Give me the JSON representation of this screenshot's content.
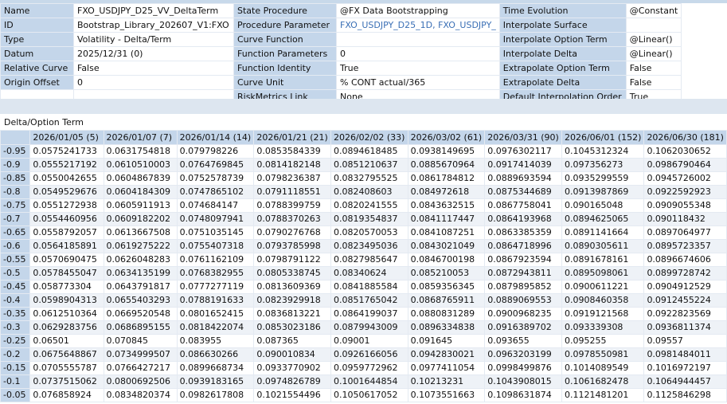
{
  "properties": [
    [
      {
        "label": "Name",
        "value": "FXO_USDJPY_D25_VV_DeltaTerm"
      },
      {
        "label": "State Procedure",
        "value": "@FX Data Bootstrapping"
      },
      {
        "label": "Time Evolution",
        "value": "@Constant"
      }
    ],
    [
      {
        "label": "ID",
        "value": "Bootstrap_Library_202607_V1:FXO"
      },
      {
        "label": "Procedure Parameter",
        "value": "FXO_USDJPY_D25_1D, FXO_USDJPY_",
        "link": true
      },
      {
        "label": "Interpolate Surface",
        "value": ""
      }
    ],
    [
      {
        "label": "Type",
        "value": "Volatility - Delta/Term"
      },
      {
        "label": "Curve Function",
        "value": ""
      },
      {
        "label": "Interpolate Option Term",
        "value": "@Linear()"
      }
    ],
    [
      {
        "label": "Datum",
        "value": "2025/12/31 (0)"
      },
      {
        "label": "Function Parameters",
        "value": "0"
      },
      {
        "label": "Interpolate Delta",
        "value": "@Linear()"
      }
    ],
    [
      {
        "label": "Relative Curve",
        "value": "False"
      },
      {
        "label": "Function Identity",
        "value": "True"
      },
      {
        "label": "Extrapolate Option Term",
        "value": "False"
      }
    ],
    [
      {
        "label": "Origin Offset",
        "value": "0"
      },
      {
        "label": "Curve Unit",
        "value": "% CONT actual/365"
      },
      {
        "label": "Extrapolate Delta",
        "value": "False"
      }
    ],
    [
      {
        "label": "",
        "value": ""
      },
      {
        "label": "RiskMetrics Link",
        "value": "None"
      },
      {
        "label": "Default Interpolation Order",
        "value": "True"
      }
    ]
  ],
  "grid": {
    "title": "Delta/Option Term",
    "columns": [
      "2026/01/05 (5)",
      "2026/01/07 (7)",
      "2026/01/14 (14)",
      "2026/01/21 (21)",
      "2026/02/02 (33)",
      "2026/03/02 (61)",
      "2026/03/31 (90)",
      "2026/06/01 (152)",
      "2026/06/30 (181)"
    ],
    "rows": [
      {
        "delta": "-0.95",
        "values": [
          "0.0575241733",
          "0.0631754818",
          "0.079798226",
          "0.0853584339",
          "0.0894618485",
          "0.0938149695",
          "0.0976302117",
          "0.1045312324",
          "0.1062030652"
        ]
      },
      {
        "delta": "-0.9",
        "values": [
          "0.0555217192",
          "0.0610510003",
          "0.0764769845",
          "0.0814182148",
          "0.0851210637",
          "0.0885670964",
          "0.0917414039",
          "0.097356273",
          "0.0986790464"
        ]
      },
      {
        "delta": "-0.85",
        "values": [
          "0.0550042655",
          "0.0604867839",
          "0.0752578739",
          "0.0798236387",
          "0.0832795525",
          "0.0861784812",
          "0.0889693594",
          "0.0935299559",
          "0.0945726002"
        ]
      },
      {
        "delta": "-0.8",
        "values": [
          "0.0549529676",
          "0.0604184309",
          "0.0747865102",
          "0.0791118551",
          "0.082408603",
          "0.084972618",
          "0.0875344689",
          "0.0913987869",
          "0.0922592923"
        ]
      },
      {
        "delta": "-0.75",
        "values": [
          "0.0551272938",
          "0.0605911913",
          "0.074684147",
          "0.0788399759",
          "0.0820241555",
          "0.0843632515",
          "0.0867758041",
          "0.090165048",
          "0.0909055348"
        ]
      },
      {
        "delta": "-0.7",
        "values": [
          "0.0554460956",
          "0.0609182202",
          "0.0748097941",
          "0.0788370263",
          "0.0819354837",
          "0.0841117447",
          "0.0864193968",
          "0.0894625065",
          "0.090118432"
        ]
      },
      {
        "delta": "-0.65",
        "values": [
          "0.0558792057",
          "0.0613667508",
          "0.0751035145",
          "0.0790276768",
          "0.0820570053",
          "0.0841087251",
          "0.0863385359",
          "0.0891141664",
          "0.0897064977"
        ]
      },
      {
        "delta": "-0.6",
        "values": [
          "0.0564185891",
          "0.0619275222",
          "0.0755407318",
          "0.0793785998",
          "0.0823495036",
          "0.0843021049",
          "0.0864718996",
          "0.0890305611",
          "0.0895723357"
        ]
      },
      {
        "delta": "-0.55",
        "values": [
          "0.0570690475",
          "0.0626048283",
          "0.0761162109",
          "0.0798791122",
          "0.0827985647",
          "0.0846700198",
          "0.0867923594",
          "0.0891678161",
          "0.0896674606"
        ]
      },
      {
        "delta": "-0.5",
        "values": [
          "0.0578455047",
          "0.0634135199",
          "0.0768382955",
          "0.0805338745",
          "0.08340624",
          "0.085210053",
          "0.0872943811",
          "0.0895098061",
          "0.0899728742"
        ]
      },
      {
        "delta": "-0.45",
        "values": [
          "0.058773304",
          "0.0643791817",
          "0.0777277119",
          "0.0813609369",
          "0.0841885584",
          "0.0859356345",
          "0.0879895852",
          "0.0900611221",
          "0.0904912529"
        ]
      },
      {
        "delta": "-0.4",
        "values": [
          "0.0598904313",
          "0.0655403293",
          "0.0788191633",
          "0.0823929918",
          "0.0851765042",
          "0.0868765911",
          "0.0889069553",
          "0.0908460358",
          "0.0912455224"
        ]
      },
      {
        "delta": "-0.35",
        "values": [
          "0.0612510364",
          "0.0669520548",
          "0.0801652415",
          "0.0836813221",
          "0.0864199037",
          "0.0880831289",
          "0.0900968235",
          "0.0919121568",
          "0.0922823569"
        ]
      },
      {
        "delta": "-0.3",
        "values": [
          "0.0629283756",
          "0.0686895155",
          "0.0818422074",
          "0.0853023186",
          "0.0879943009",
          "0.0896334838",
          "0.0916389702",
          "0.093339308",
          "0.0936811374"
        ]
      },
      {
        "delta": "-0.25",
        "values": [
          "0.06501",
          "0.070845",
          "0.083955",
          "0.087365",
          "0.09001",
          "0.091645",
          "0.093655",
          "0.095255",
          "0.09557"
        ]
      },
      {
        "delta": "-0.2",
        "values": [
          "0.0675648867",
          "0.0734999507",
          "0.086630266",
          "0.090010834",
          "0.0926166056",
          "0.0942830021",
          "0.0963203199",
          "0.0978550981",
          "0.0981484011"
        ]
      },
      {
        "delta": "-0.15",
        "values": [
          "0.0705555787",
          "0.0766427217",
          "0.0899668734",
          "0.0933770902",
          "0.0959772962",
          "0.0977411054",
          "0.0998499876",
          "0.1014089549",
          "0.1016972197"
        ]
      },
      {
        "delta": "-0.1",
        "values": [
          "0.0737515062",
          "0.0800692506",
          "0.0939183165",
          "0.0974826789",
          "0.1001644854",
          "0.10213231",
          "0.1043908015",
          "0.1061682478",
          "0.1064944457"
        ]
      },
      {
        "delta": "-0.05",
        "values": [
          "0.076858924",
          "0.0834820374",
          "0.0982617808",
          "0.1021554496",
          "0.1050617052",
          "0.1073551663",
          "0.1098631874",
          "0.1121481201",
          "0.1125846298"
        ]
      }
    ]
  }
}
